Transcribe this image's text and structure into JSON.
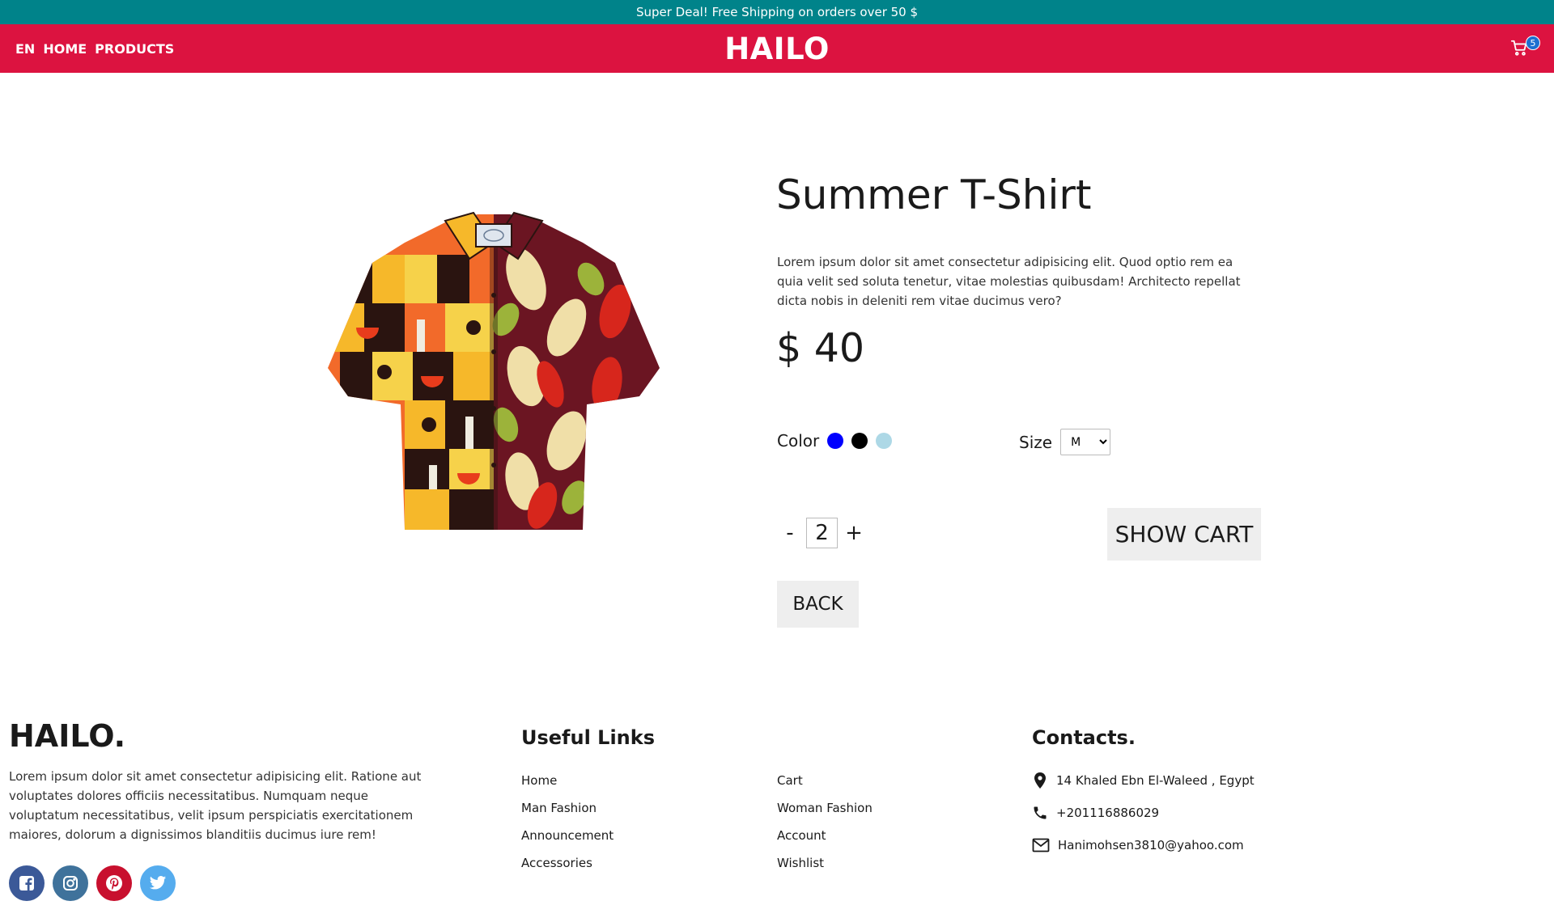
{
  "announcement": "Super Deal! Free Shipping on orders over 50 $",
  "nav": {
    "lang": "EN",
    "home": "HOME",
    "products": "PRODUCTS",
    "brand": "HAILO",
    "cart_count": "5"
  },
  "product": {
    "image_icon": "shirt-image",
    "title": "Summer T-Shirt",
    "description": "Lorem ipsum dolor sit amet consectetur adipisicing elit. Quod optio rem ea quia velit sed soluta tenetur, vitae molestias quibusdam! Architecto repellat dicta nobis in deleniti rem vitae ducimus vero?",
    "price": "$ 40",
    "color_label": "Color",
    "colors": [
      "#0000ff",
      "#000000",
      "#add8e6"
    ],
    "size_label": "Size",
    "size_value": "M",
    "qty_minus": "-",
    "qty_value": "2",
    "qty_plus": "+",
    "show_cart": "SHOW CART",
    "back": "BACK"
  },
  "footer": {
    "brand": "HAILO.",
    "description": "Lorem ipsum dolor sit amet consectetur adipisicing elit. Ratione aut voluptates dolores officiis necessitatibus. Numquam neque voluptatum necessitatibus, velit ipsum perspiciatis exercitationem maiores, dolorum a dignissimos blanditiis ducimus iure rem!",
    "socials": [
      {
        "icon": "facebook-icon",
        "color": "#3b5998"
      },
      {
        "icon": "instagram-icon",
        "color": "#3f729b"
      },
      {
        "icon": "pinterest-icon",
        "color": "#c8102e"
      },
      {
        "icon": "twitter-icon",
        "color": "#55acee"
      }
    ],
    "useful_links_title": "Useful Links",
    "links_col1": [
      "Home",
      "Man Fashion",
      "Announcement",
      "Accessories"
    ],
    "links_col2": [
      "Cart",
      "Woman Fashion",
      "Account",
      "Wishlist"
    ],
    "contacts_title": "Contacts.",
    "address": "14 Khaled Ebn El-Waleed , Egypt",
    "phone": "+201116886029",
    "email": "Hanimohsen3810@yahoo.com"
  }
}
